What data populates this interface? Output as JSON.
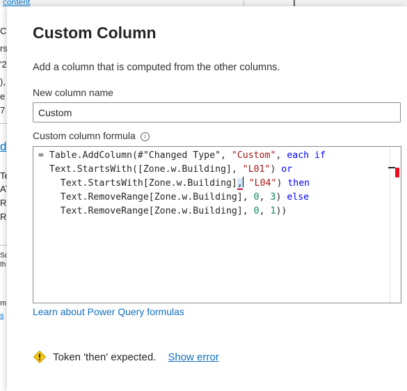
{
  "background": {
    "top_link": "content",
    "fragments": [
      "C",
      "rs",
      "'2",
      "),",
      "e",
      "7",
      "d",
      "Te",
      "AT",
      "R",
      "R",
      "So",
      "th",
      "m",
      "s"
    ]
  },
  "dialog": {
    "title": "Custom Column",
    "description": "Add a column that is computed from the other columns.",
    "name_label": "New column name",
    "name_value": "Custom",
    "formula_label": "Custom column formula",
    "info_icon": "info-icon",
    "formula_lines": [
      "= Table.AddColumn(#\"Changed Type\", \"Custom\", each if",
      "Text.StartsWith([Zone.w.Building], \"L01\") or",
      "Text.StartsWith[Zone.w.Building], \"L04\") then",
      "Text.RemoveRange[Zone.w.Building], 0, 3) else",
      "Text.RemoveRange[Zone.w.Building], 0, 1))"
    ],
    "learn_link": "Learn about Power Query formulas",
    "error_message": "Token 'then' expected.",
    "show_error_link": "Show error",
    "warning_icon": "warning-icon",
    "colors": {
      "keyword": "#0000ff",
      "string": "#a31515",
      "number": "#098658",
      "link": "#106ebe",
      "error": "#e81123",
      "warning": "#f2c811"
    }
  }
}
